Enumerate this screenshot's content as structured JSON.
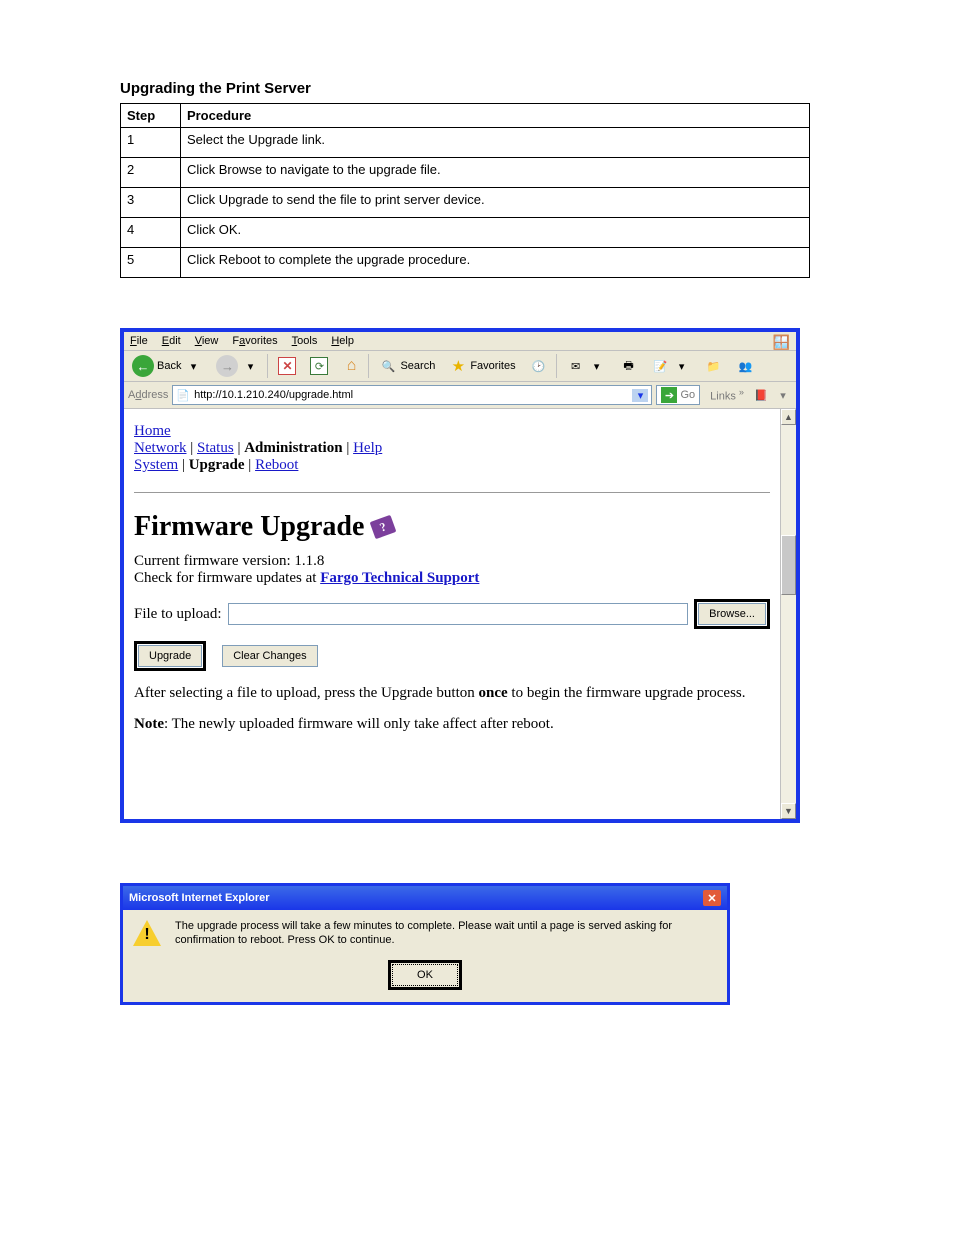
{
  "doc": {
    "section_title": "Upgrading the Print Server",
    "table_headers": {
      "step": "Step",
      "procedure": "Procedure"
    },
    "steps": [
      {
        "n": "1",
        "text": "Select the Upgrade link."
      },
      {
        "n": "2",
        "text": "Click Browse to navigate to the upgrade file."
      },
      {
        "n": "3",
        "text": "Click Upgrade to send the file to print server device."
      },
      {
        "n": "4",
        "text": "Click OK."
      },
      {
        "n": "5",
        "text": "Click Reboot to complete the upgrade procedure."
      }
    ]
  },
  "browser": {
    "menus": [
      {
        "key": "file",
        "pre": "",
        "ul": "F",
        "post": "ile"
      },
      {
        "key": "edit",
        "pre": "",
        "ul": "E",
        "post": "dit"
      },
      {
        "key": "view",
        "pre": "",
        "ul": "V",
        "post": "iew"
      },
      {
        "key": "favorites",
        "pre": "F",
        "ul": "a",
        "post": "vorites"
      },
      {
        "key": "tools",
        "pre": "",
        "ul": "T",
        "post": "ools"
      },
      {
        "key": "help",
        "pre": "",
        "ul": "H",
        "post": "elp"
      }
    ],
    "back_label": "Back",
    "search_label": "Search",
    "favorites_label": "Favorites",
    "addr_label_pre": "A",
    "addr_label_ul": "d",
    "addr_label_post": "dress",
    "address_value": "http://10.1.210.240/upgrade.html",
    "go_label": "Go",
    "links_label": "Links"
  },
  "content": {
    "home": "Home",
    "nav1": {
      "network": "Network",
      "status": "Status",
      "admin": "Administration",
      "help": "Help"
    },
    "nav2": {
      "system": "System",
      "upgrade": "Upgrade",
      "reboot": "Reboot"
    },
    "title": "Firmware Upgrade",
    "version_line": "Current firmware version: 1.1.8",
    "check_prefix": "Check for firmware updates at ",
    "check_link": "Fargo Technical Support",
    "file_label": "File to upload:",
    "browse_btn": "Browse...",
    "upgrade_btn": "Upgrade",
    "clear_btn": "Clear Changes",
    "para_a": "After selecting a file to upload, press the Upgrade button ",
    "para_b_bold": "once",
    "para_c": " to begin the firmware upgrade process.",
    "note_label": "Note",
    "note_text": ": The newly uploaded firmware will only take affect after reboot."
  },
  "dialog": {
    "title": "Microsoft Internet Explorer",
    "message": "The upgrade process will take a few minutes to complete. Please wait until a page is served asking for confirmation to reboot. Press OK to continue.",
    "ok": "OK"
  }
}
